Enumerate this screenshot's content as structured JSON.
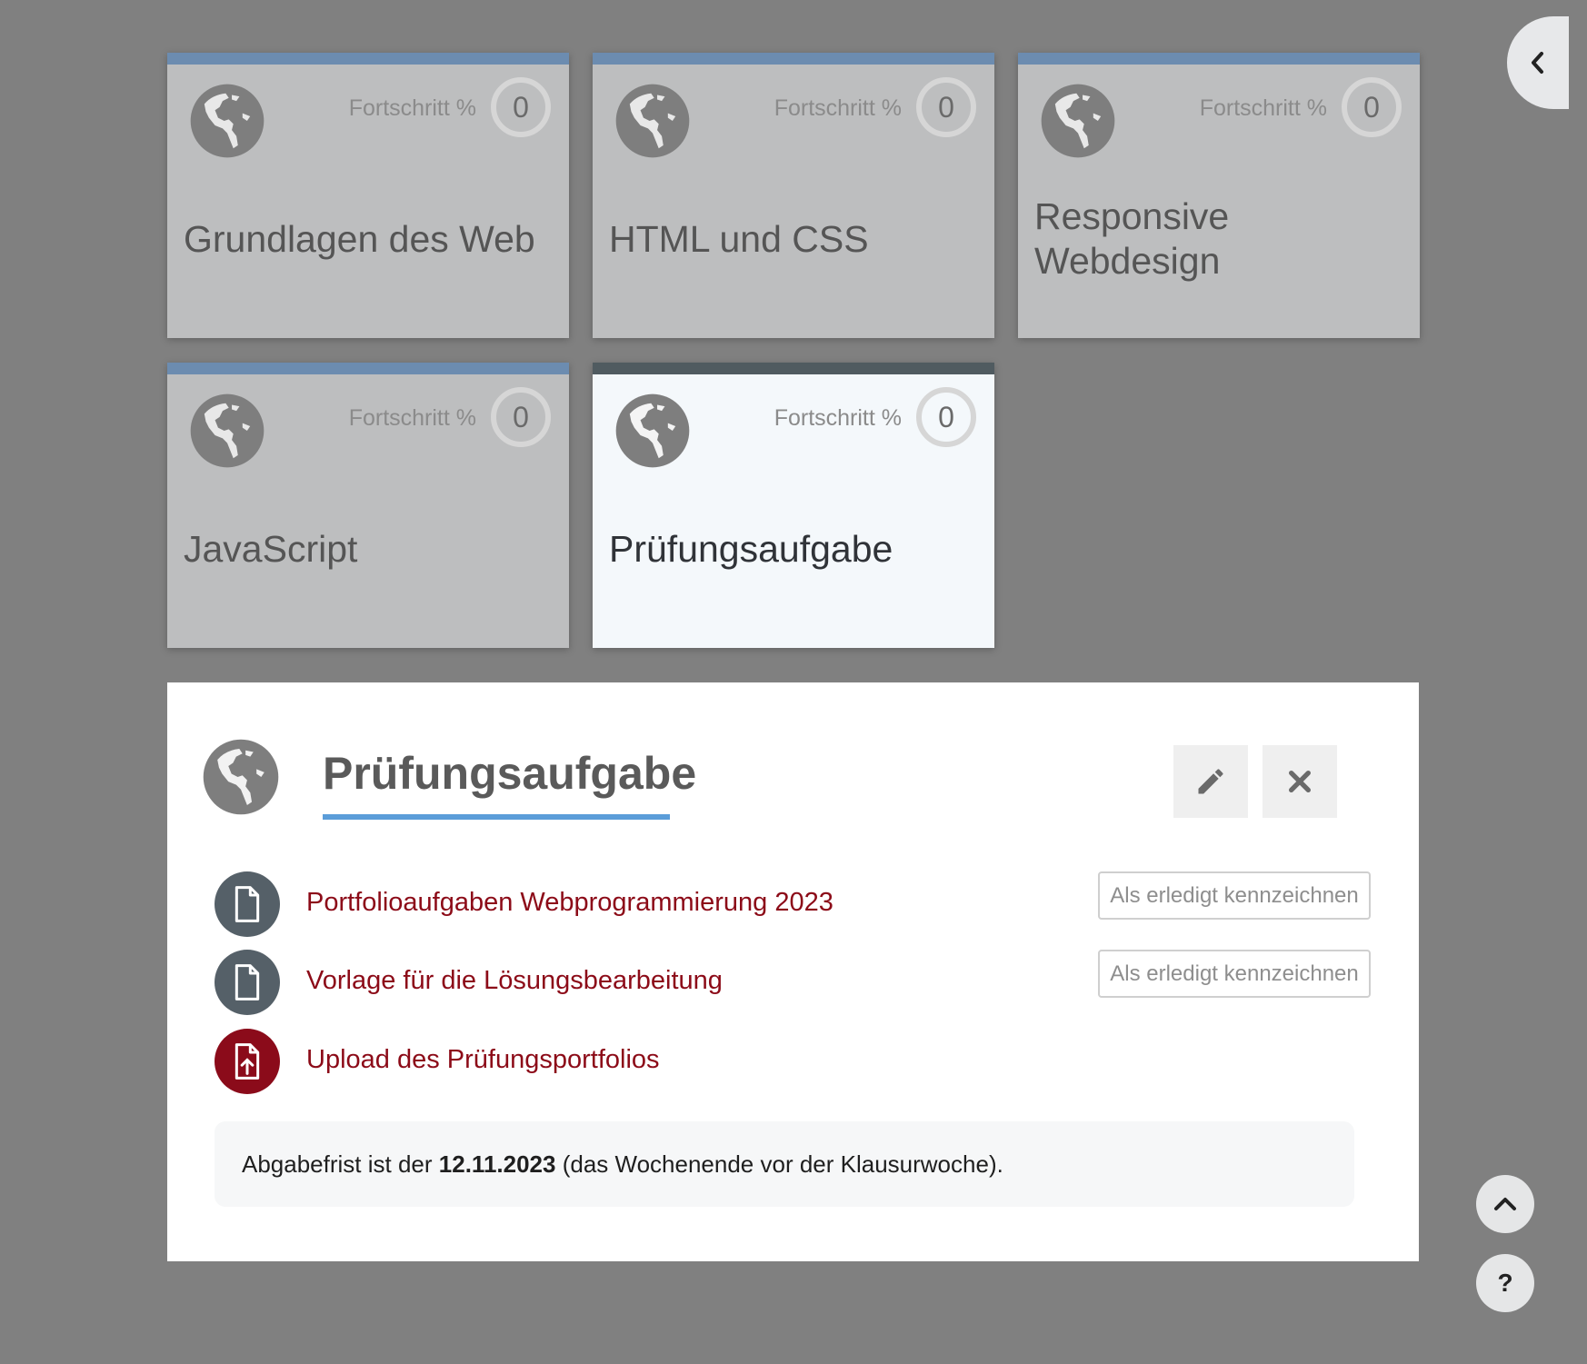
{
  "tiles": [
    {
      "title": "Grundlagen des Web",
      "progress_label": "Fortschritt %",
      "progress_value": "0",
      "active": false
    },
    {
      "title": "HTML und CSS",
      "progress_label": "Fortschritt %",
      "progress_value": "0",
      "active": false
    },
    {
      "title": "Responsive Webdesign",
      "progress_label": "Fortschritt %",
      "progress_value": "0",
      "active": false
    },
    {
      "title": "JavaScript",
      "progress_label": "Fortschritt %",
      "progress_value": "0",
      "active": false
    },
    {
      "title": "Prüfungsaufgabe",
      "progress_label": "Fortschritt %",
      "progress_value": "0",
      "active": true
    }
  ],
  "panel": {
    "title": "Prüfungsaufgabe",
    "edit_icon": "pencil-icon",
    "close_icon": "close-icon",
    "activities": [
      {
        "label": "Portfolioaufgaben Webprogrammierung 2023",
        "icon": "file-icon",
        "mark_done_label": "Als erledigt kennzeichnen"
      },
      {
        "label": "Vorlage für die Lösungsbearbeitung",
        "icon": "file-icon",
        "mark_done_label": "Als erledigt kennzeichnen"
      },
      {
        "label": "Upload des Prüfungsportfolios",
        "icon": "file-upload-icon"
      }
    ],
    "note": {
      "prefix": "Abgabefrist ist der ",
      "date": "12.11.2023",
      "suffix": " (das Wochenende vor der Klausurwoche)."
    }
  },
  "colors": {
    "background": "#808080",
    "tile_bg": "#bdbebf",
    "tile_active_bg": "#f4f8fb",
    "tile_border": "#6c8cb0",
    "tile_active_border": "#505b60",
    "link": "#8c0b18",
    "underline": "#5b9dd9"
  },
  "floating": {
    "sidebar_toggle_icon": "chevron-left-icon",
    "scroll_top_icon": "chevron-up-icon",
    "help_label": "?"
  }
}
